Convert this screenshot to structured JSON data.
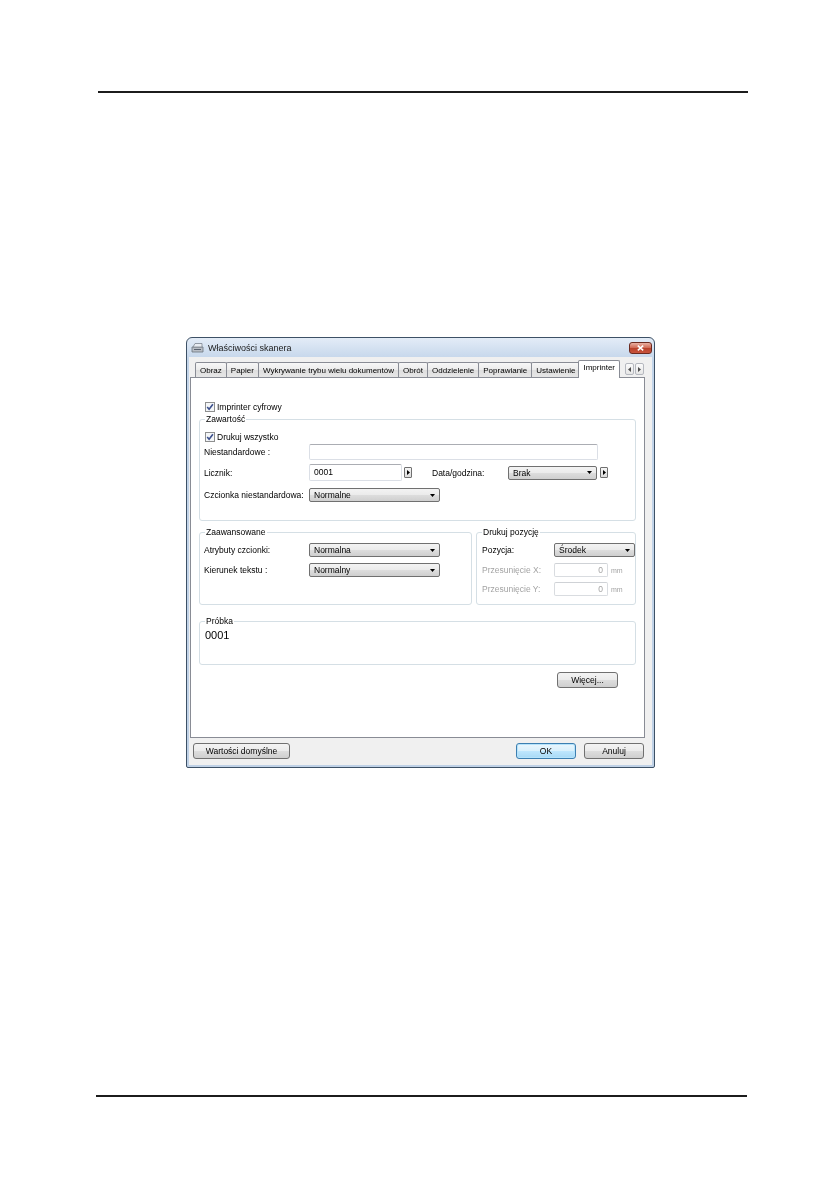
{
  "window": {
    "title": "Właściwości skanera"
  },
  "tabs": [
    {
      "label": "Obraz",
      "selected": false
    },
    {
      "label": "Papier",
      "selected": false
    },
    {
      "label": "Wykrywanie trybu wielu dokumentów",
      "selected": false
    },
    {
      "label": "Obrót",
      "selected": false
    },
    {
      "label": "Oddzielenie",
      "selected": false
    },
    {
      "label": "Poprawianie",
      "selected": false
    },
    {
      "label": "Ustawienie",
      "selected": false
    },
    {
      "label": "Imprinter",
      "selected": true
    }
  ],
  "digital_imprinter": {
    "label": "Imprinter cyfrowy",
    "checked": true
  },
  "content_group": {
    "title": "Zawartość",
    "print_all": {
      "label": "Drukuj wszystko",
      "checked": true
    },
    "custom_text": {
      "label": "Niestandardowe :"
    },
    "counter": {
      "label": "Licznik:",
      "value": "0001"
    },
    "date_time": {
      "label": "Data/godzina:",
      "value": "Brak"
    },
    "custom_font": {
      "label": "Czcionka niestandardowa:",
      "value": "Normalne"
    }
  },
  "advanced_group": {
    "title": "Zaawansowane",
    "rows": [
      {
        "label": "Atrybuty czcionki:",
        "value": "Normalna"
      },
      {
        "label": "Kierunek tekstu :",
        "value": "Normalny"
      }
    ]
  },
  "position_group": {
    "title": "Drukuj pozycję",
    "position": {
      "label": "Pozycja:",
      "value": "Środek"
    },
    "offsets": [
      {
        "label": "Przesunięcie X:",
        "value": "0",
        "unit": "mm",
        "disabled": true
      },
      {
        "label": "Przesunięcie Y:",
        "value": "0",
        "unit": "mm",
        "disabled": true
      }
    ]
  },
  "sample_group": {
    "title": "Próbka",
    "text": "0001"
  },
  "more_button": {
    "label": "Więcej..."
  },
  "footer": {
    "left_buttons": [
      {
        "label": "Wartości domyślne",
        "default": false
      }
    ],
    "right_buttons": [
      {
        "label": "OK",
        "default": true
      },
      {
        "label": "Anuluj",
        "default": false
      }
    ]
  }
}
